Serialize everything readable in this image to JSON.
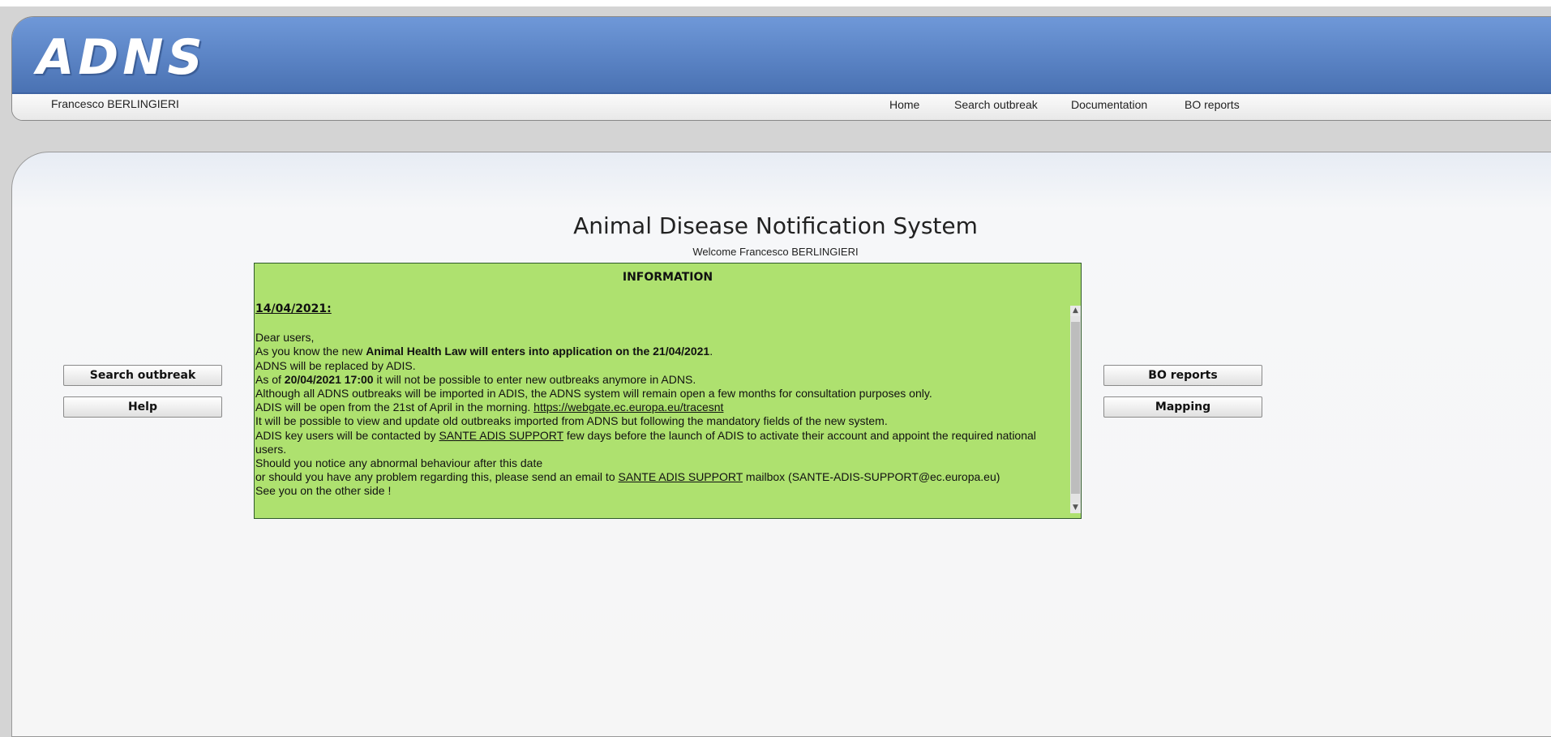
{
  "app": {
    "logo": "ADNS"
  },
  "user": {
    "name": "Francesco BERLINGIERI"
  },
  "nav": {
    "home": "Home",
    "search_outbreak": "Search outbreak",
    "documentation": "Documentation",
    "bo_reports": "BO reports"
  },
  "page": {
    "title": "Animal Disease Notification System",
    "welcome": "Welcome Francesco BERLINGIERI"
  },
  "buttons": {
    "search_outbreak": "Search outbreak",
    "help": "Help",
    "bo_reports": "BO reports",
    "mapping": "Mapping"
  },
  "info": {
    "heading": "INFORMATION",
    "date": "14/04/2021:",
    "greeting": "Dear users,",
    "l1_pre": "As you know the new ",
    "l1_bold": "Animal Health Law will enters into application on the 21/04/2021",
    "l1_post": ".",
    "l2": "ADNS will be replaced by ADIS.",
    "l3_pre": "As of ",
    "l3_bold": "20/04/2021 17:00",
    "l3_post": " it will not be possible to enter new outbreaks anymore in ADNS.",
    "l4": "Although all ADNS outbreaks will be imported in ADIS, the ADNS system will remain open a few months for consultation purposes only.",
    "l5_pre": "ADIS will be open from the 21st of April in the morning. ",
    "l5_link": "https://webgate.ec.europa.eu/tracesnt",
    "l6": "It will be possible to view and update old outbreaks imported from ADNS but following the mandatory fields of the new system.",
    "l7_pre": "ADIS key users will be contacted by ",
    "l7_link": "SANTE ADIS SUPPORT",
    "l7_post": " few days before the launch of ADIS to activate their account and appoint the required national users.",
    "l8": "Should you notice any abnormal behaviour after this date",
    "l9_pre": "or should you have any problem regarding this, please send an email to ",
    "l9_link": "SANTE ADIS SUPPORT",
    "l9_post": " mailbox (SANTE-ADIS-SUPPORT@ec.europa.eu)",
    "l10": "See you on the other side !"
  }
}
